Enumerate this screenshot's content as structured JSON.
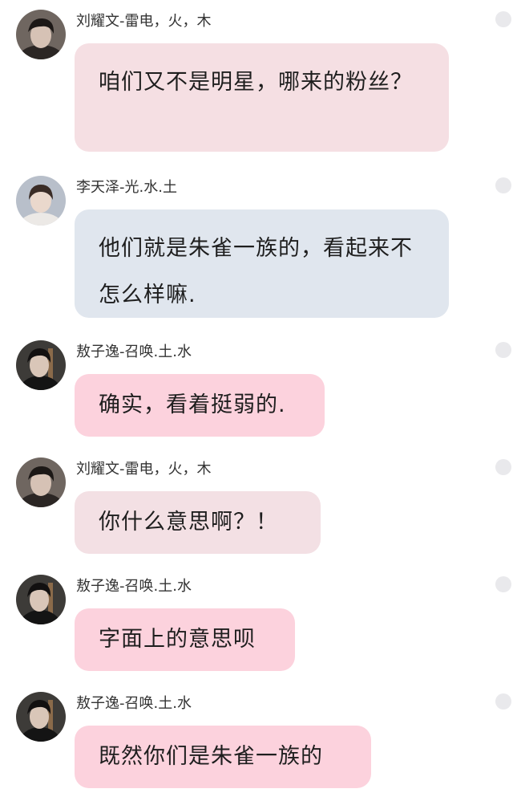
{
  "messages": [
    {
      "sender": "刘耀文-雷电，火，木",
      "text": "咱们又不是明星，哪来的粉丝？",
      "avatar": "avatar-liu"
    },
    {
      "sender": "李天泽-光.水.土",
      "text": "他们就是朱雀一族的，看起来不怎么样嘛.",
      "avatar": "avatar-li"
    },
    {
      "sender": "敖子逸-召唤.土.水",
      "text": "确实，看着挺弱的.",
      "avatar": "avatar-ao"
    },
    {
      "sender": "刘耀文-雷电，火，木",
      "text": "你什么意思啊？！",
      "avatar": "avatar-liu"
    },
    {
      "sender": "敖子逸-召唤.土.水",
      "text": "字面上的意思呗",
      "avatar": "avatar-ao"
    },
    {
      "sender": "敖子逸-召唤.土.水",
      "text": "既然你们是朱雀一族的",
      "avatar": "avatar-ao"
    }
  ],
  "colors": {
    "bubble_rose": "#f5dfe3",
    "bubble_blue": "#e0e6ee",
    "bubble_pink": "#fcd2dd",
    "bubble_grey": "#f3e0e4",
    "status_dot": "#e9e9ec"
  }
}
